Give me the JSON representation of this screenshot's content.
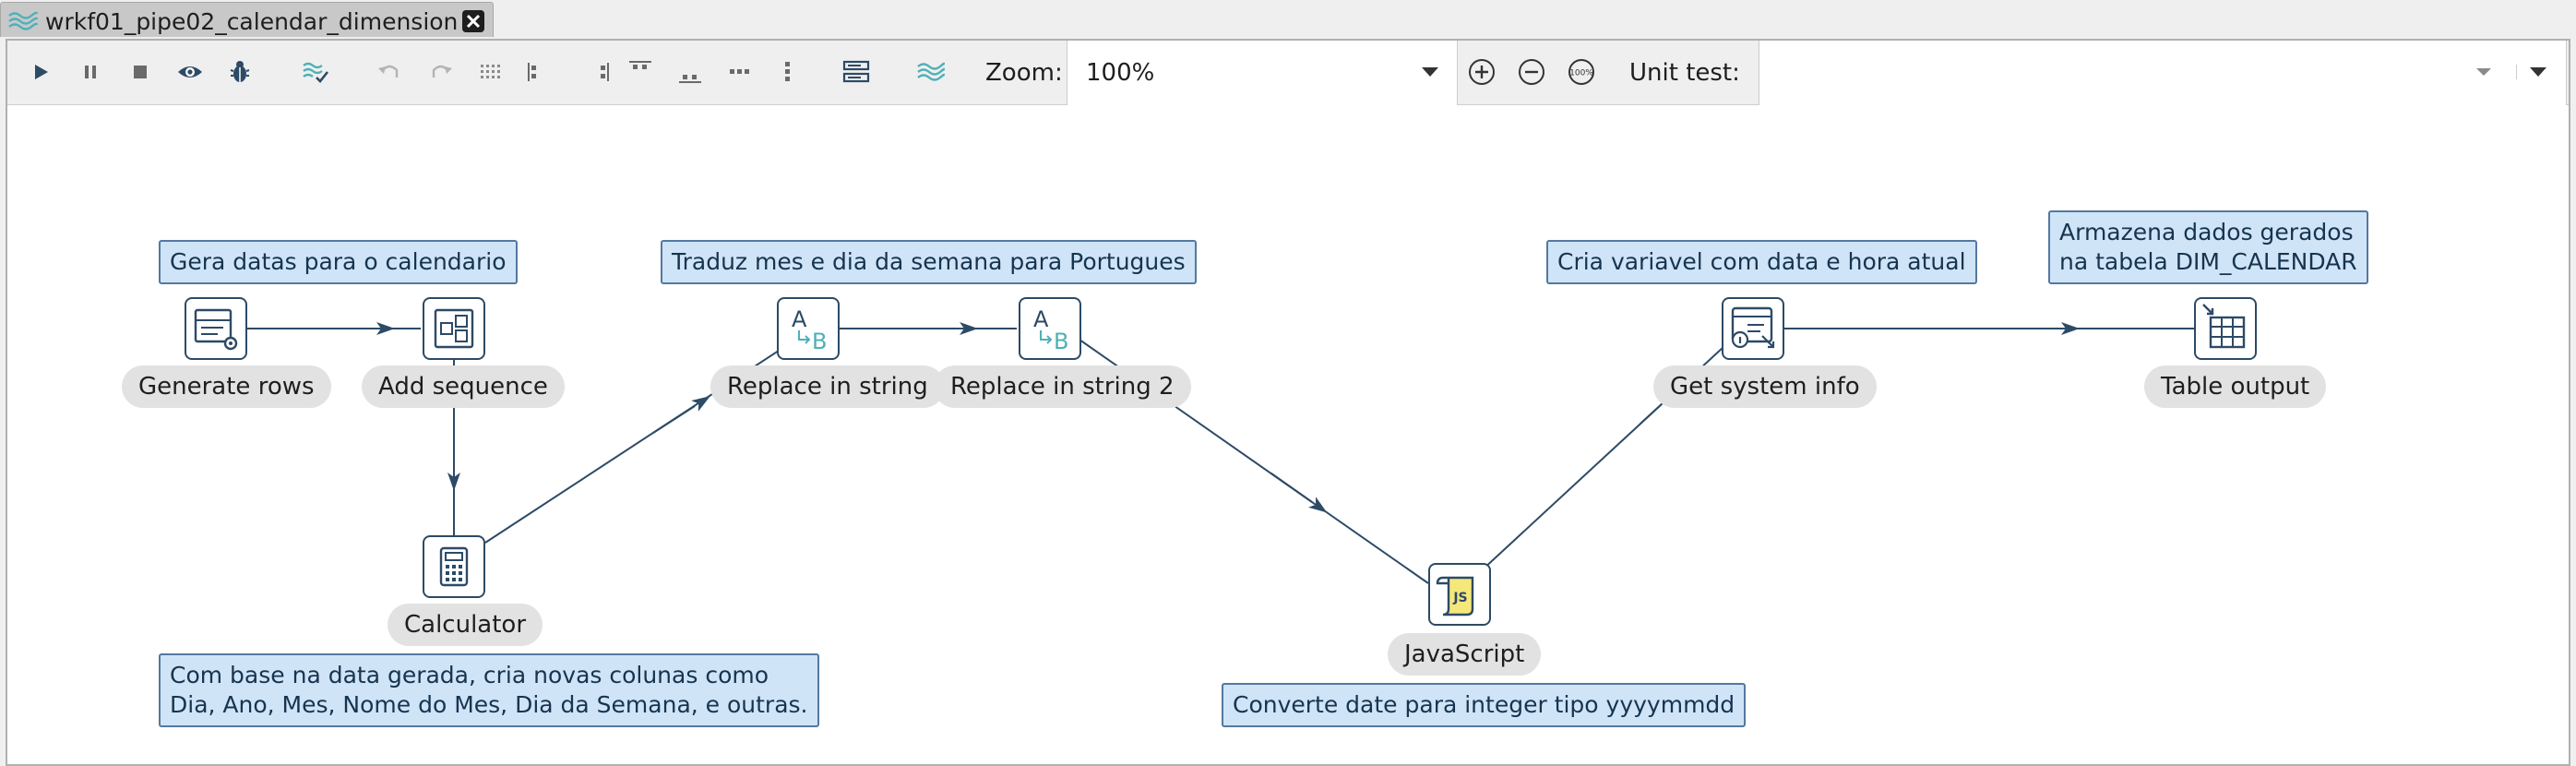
{
  "tab": {
    "title": "wrkf01_pipe02_calendar_dimension",
    "icon": "transformation-icon",
    "close_icon": "close-icon"
  },
  "toolbar": {
    "buttons": [
      "run",
      "pause",
      "stop",
      "preview",
      "debug",
      "check",
      "undo",
      "redo",
      "align-snap",
      "align-left",
      "align-right",
      "align-top",
      "align-bottom",
      "distribute-horizontal",
      "distribute-vertical",
      "show-results",
      "pipeline-icon",
      "zoom-in",
      "zoom-out",
      "zoom-100"
    ],
    "zoom_label": "Zoom:",
    "zoom_value": "100%",
    "unit_test_label": "Unit test:",
    "unit_test_value": "",
    "zoom_100_text": "100%"
  },
  "canvas": {
    "steps": {
      "generate_rows": "Generate rows",
      "add_sequence": "Add sequence",
      "calculator": "Calculator",
      "replace_in_string": "Replace in string",
      "replace_in_string_2": "Replace in string 2",
      "javascript": "JavaScript",
      "get_system_info": "Get system info",
      "table_output": "Table output"
    },
    "notes": {
      "generate": "Gera datas para o calendario",
      "calculator": "Com base na data gerada, cria novas colunas como\nDia, Ano, Mes, Nome do Mes, Dia da Semana, e outras.",
      "replace": "Traduz mes e dia da semana para Portugues",
      "javascript": "Converte date para integer tipo yyyymmdd",
      "system_info": "Cria variavel com data e hora atual",
      "table_output": "Armazena dados gerados\nna tabela DIM_CALENDAR"
    },
    "js_icon_text": "JS",
    "replace_icon_text_a": "A",
    "replace_icon_text_b": "B"
  },
  "colors": {
    "note_fill": "#cfe4f7",
    "note_border": "#5478a0",
    "step_border": "#2d4a66",
    "hop": "#2d4a66",
    "accent_teal": "#4fb0b8",
    "label_bg": "#e2e2e2"
  }
}
